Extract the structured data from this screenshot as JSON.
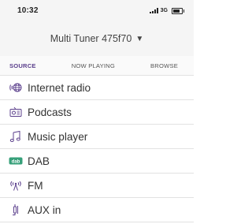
{
  "status_bar": {
    "time": "10:32",
    "network": "3G"
  },
  "header": {
    "title": "Multi Tuner 475f70",
    "caret": "▼"
  },
  "tabs": [
    {
      "label": "SOURCE"
    },
    {
      "label": "NOW PLAYING"
    },
    {
      "label": "BROWSE"
    }
  ],
  "sources": [
    {
      "label": "Internet radio",
      "icon": "internet-radio-icon"
    },
    {
      "label": "Podcasts",
      "icon": "podcast-radio-icon"
    },
    {
      "label": "Music player",
      "icon": "music-note-icon"
    },
    {
      "label": "DAB",
      "icon": "dab-icon",
      "icon_text": "dab"
    },
    {
      "label": "FM",
      "icon": "fm-antenna-icon"
    },
    {
      "label": "AUX in",
      "icon": "aux-plug-icon"
    }
  ],
  "colors": {
    "accent": "#5b3f8c",
    "icon_green": "#37a07a"
  }
}
